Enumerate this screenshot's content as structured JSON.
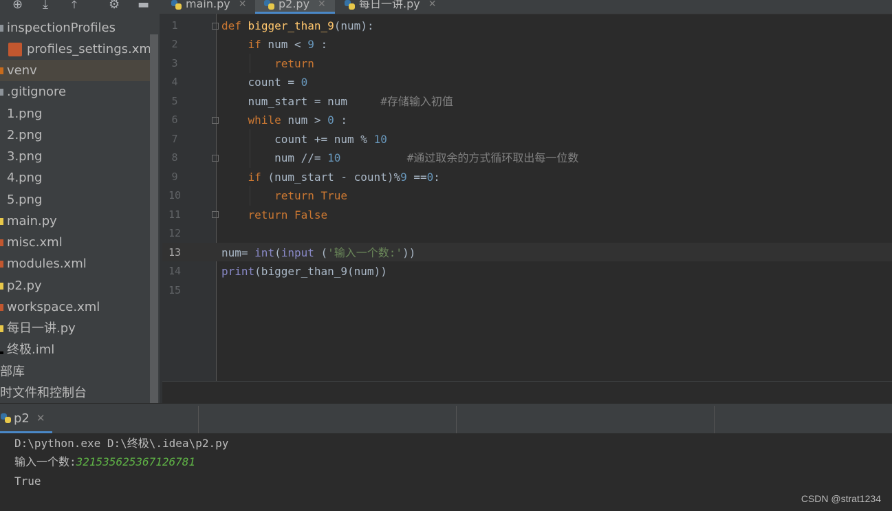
{
  "toolbar": {
    "icons": [
      "add-icon",
      "collapse-all-icon",
      "expand-all-icon",
      "gear-icon",
      "minimize-icon"
    ]
  },
  "tabs": [
    {
      "label": "main.py",
      "active": false
    },
    {
      "label": "p2.py",
      "active": true
    },
    {
      "label": "每日一讲.py",
      "active": false
    }
  ],
  "sidebar": {
    "items": [
      {
        "label": "inspectionProfiles",
        "type": "folder"
      },
      {
        "label": "profiles_settings.xml",
        "type": "xml"
      },
      {
        "label": "venv",
        "type": "folder",
        "selected": true
      },
      {
        "label": ".gitignore",
        "type": "file"
      },
      {
        "label": "1.png",
        "type": "image"
      },
      {
        "label": "2.png",
        "type": "image"
      },
      {
        "label": "3.png",
        "type": "image"
      },
      {
        "label": "4.png",
        "type": "image"
      },
      {
        "label": "5.png",
        "type": "image"
      },
      {
        "label": "main.py",
        "type": "python"
      },
      {
        "label": "misc.xml",
        "type": "xml"
      },
      {
        "label": "modules.xml",
        "type": "xml"
      },
      {
        "label": "p2.py",
        "type": "python"
      },
      {
        "label": "workspace.xml",
        "type": "xml"
      },
      {
        "label": "每日一讲.py",
        "type": "python"
      },
      {
        "label": "终极.iml",
        "type": "iml"
      },
      {
        "label": "部库",
        "type": "library"
      },
      {
        "label": "时文件和控制台",
        "type": "scratches"
      }
    ]
  },
  "editor": {
    "line_numbers": [
      "1",
      "2",
      "3",
      "4",
      "5",
      "6",
      "7",
      "8",
      "9",
      "10",
      "11",
      "12",
      "13",
      "14",
      "15"
    ],
    "current_line": "13",
    "code": {
      "l1_kw": "def",
      "l1_fn": "bigger_than_9",
      "l1_rest": "(num):",
      "l2_kw": "if",
      "l2_a": " num < ",
      "l2_num": "9",
      "l2_b": " :",
      "l3_kw": "return",
      "l4_a": "count = ",
      "l4_num": "0",
      "l5_a": "num_start = num",
      "l5_cm": "#存储输入初值",
      "l6_kw": "while",
      "l6_a": " num > ",
      "l6_num": "0",
      "l6_b": " :",
      "l7_a": "count += num % ",
      "l7_num": "10",
      "l8_a": "num //= ",
      "l8_num": "10",
      "l8_cm": "#通过取余的方式循环取出每一位数",
      "l9_kw": "if",
      "l9_a": " (num_start - count)%",
      "l9_num1": "9",
      "l9_b": " ==",
      "l9_num2": "0",
      "l9_c": ":",
      "l10_kw": "return True",
      "l11_kw": "return False",
      "l13_a": "num= ",
      "l13_bi1": "int",
      "l13_b": "(",
      "l13_bi2": "input",
      "l13_c": " (",
      "l13_str": "'输入一个数:'",
      "l13_d": "))",
      "l14_bi": "print",
      "l14_a": "(bigger_than_9(num))"
    }
  },
  "run": {
    "tab_label": "p2",
    "console": {
      "command": "D:\\python.exe D:\\终极\\.idea\\p2.py",
      "prompt": "输入一个数:",
      "user_input": "321535625367126781",
      "output": "True"
    }
  },
  "watermark": "CSDN @strat1234",
  "colors": {
    "keyword": "#cc7832",
    "function": "#ffc66d",
    "number": "#6897bb",
    "comment": "#808080",
    "string": "#6a8759",
    "builtin": "#8888c6",
    "user_input": "#5fb346",
    "accent": "#4a88c7"
  }
}
